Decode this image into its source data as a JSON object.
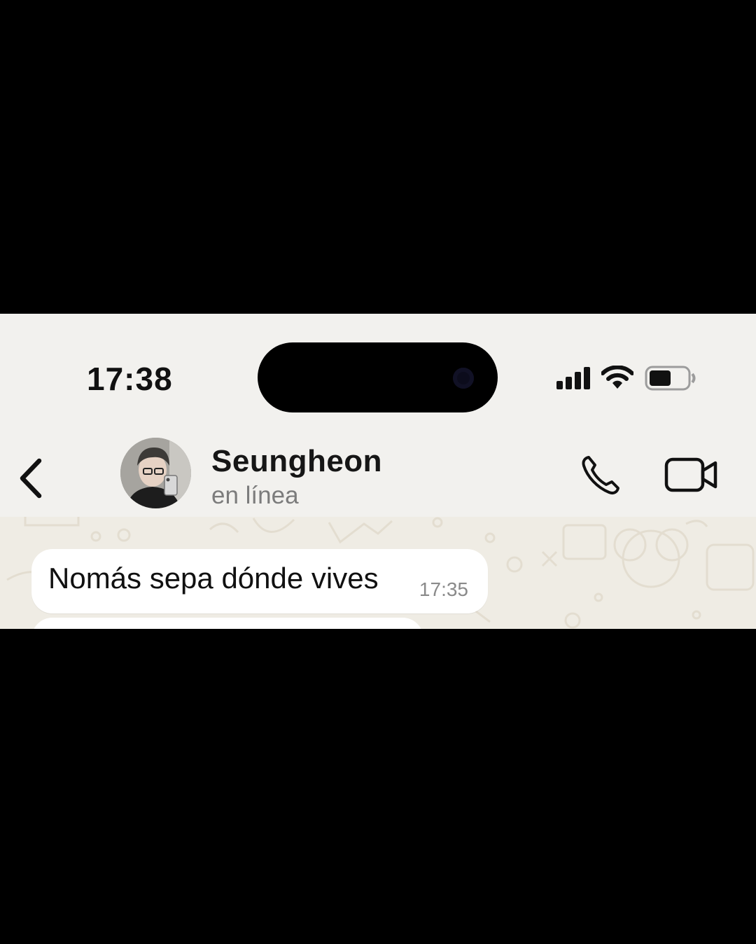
{
  "status_bar": {
    "time": "17:38",
    "icons": [
      "cellular-signal-icon",
      "wifi-icon",
      "battery-icon"
    ],
    "battery_level": 0.55
  },
  "header": {
    "contact_name": "Seungheon",
    "presence": "en línea",
    "icons": [
      "back-chevron-icon",
      "phone-icon",
      "video-camera-icon"
    ]
  },
  "messages": [
    {
      "direction": "incoming",
      "text": "Nomás sepa dónde vives",
      "time": "17:35"
    }
  ],
  "colors": {
    "background": "#f2f1ee",
    "chat_wallpaper": "#efece4",
    "bubble_incoming": "#ffffff",
    "secondary_text": "#7c7c7c"
  }
}
